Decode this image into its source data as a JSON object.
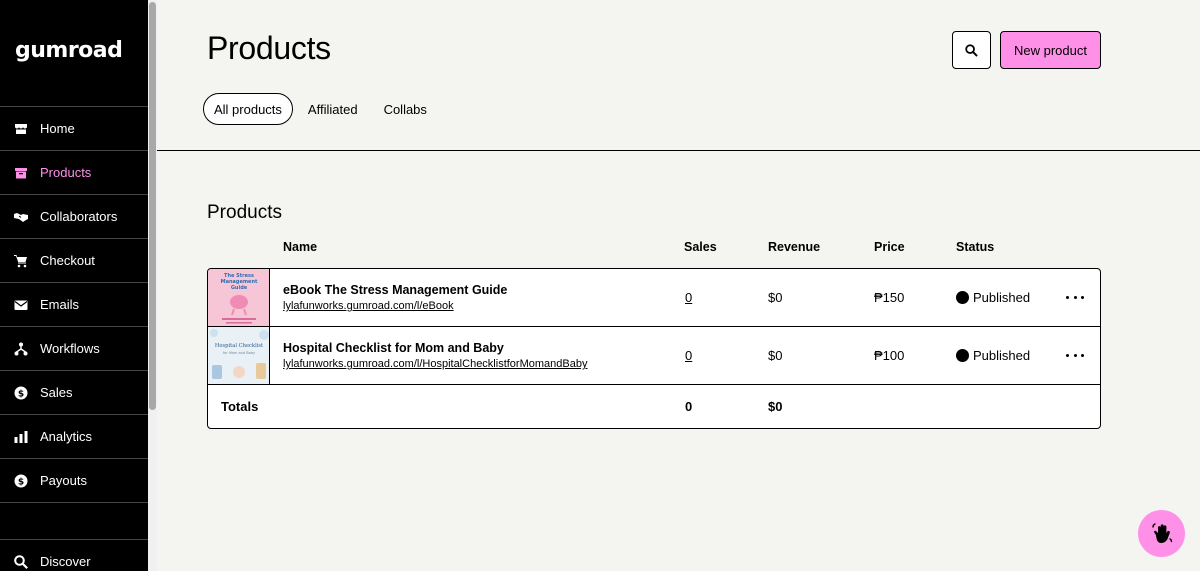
{
  "app": {
    "logo": "GUMROAD"
  },
  "sidebar": {
    "items": [
      {
        "label": "Home",
        "icon": "store-icon",
        "active": false
      },
      {
        "label": "Products",
        "icon": "archive-icon",
        "active": true
      },
      {
        "label": "Collaborators",
        "icon": "handshake-icon",
        "active": false
      },
      {
        "label": "Checkout",
        "icon": "cart-icon",
        "active": false
      },
      {
        "label": "Emails",
        "icon": "envelope-icon",
        "active": false
      },
      {
        "label": "Workflows",
        "icon": "workflow-icon",
        "active": false
      },
      {
        "label": "Sales",
        "icon": "dollar-circle-icon",
        "active": false
      },
      {
        "label": "Analytics",
        "icon": "bar-chart-icon",
        "active": false
      },
      {
        "label": "Payouts",
        "icon": "dollar-circle-icon",
        "active": false
      }
    ],
    "discover": "Discover"
  },
  "header": {
    "title": "Products",
    "new_button": "New product",
    "tabs": [
      "All products",
      "Affiliated",
      "Collabs"
    ]
  },
  "products": {
    "section_title": "Products",
    "columns": {
      "name": "Name",
      "sales": "Sales",
      "revenue": "Revenue",
      "price": "Price",
      "status": "Status"
    },
    "rows": [
      {
        "name": "eBook The Stress Management Guide",
        "url": "lylafunworks.gumroad.com/l/eBook",
        "sales": "0",
        "revenue": "$0",
        "price": "₱150",
        "status": "Published",
        "thumb_text": "The Stress Management Guide"
      },
      {
        "name": "Hospital Checklist for Mom and Baby",
        "url": "lylafunworks.gumroad.com/l/HospitalChecklistforMomandBaby",
        "sales": "0",
        "revenue": "$0",
        "price": "₱100",
        "status": "Published",
        "thumb_text": "Hospital Checklist"
      }
    ],
    "totals": {
      "label": "Totals",
      "sales": "0",
      "revenue": "$0"
    }
  },
  "colors": {
    "accent": "#ff90e8",
    "sidebar_bg": "#000000",
    "page_bg": "#f4f4f0"
  }
}
